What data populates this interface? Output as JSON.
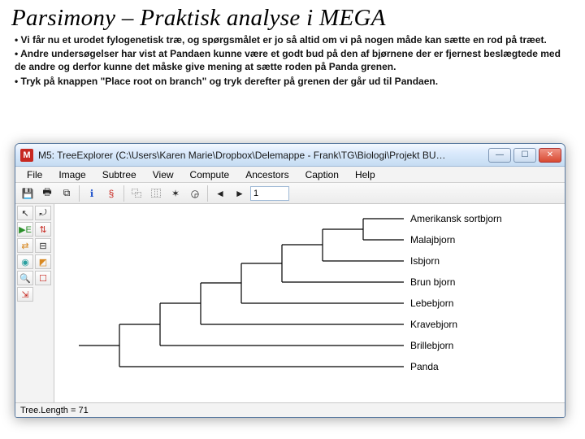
{
  "slide": {
    "title": "Parsimony – Praktisk analyse i MEGA",
    "bullets": [
      "• Vi får nu et urodet fylogenetisk træ, og spørgsmålet er jo så altid om vi på nogen måde kan sætte en rod på træet.",
      "• Andre undersøgelser har vist at Pandaen kunne være et godt bud på den af bjørnene der er fjernest beslægtede med de andre og derfor kunne det måske give mening at sætte roden på Panda grenen.",
      "• Tryk på knappen \"Place root on branch\" og tryk derefter på grenen der går ud til Pandaen."
    ]
  },
  "window": {
    "app_icon_letter": "M",
    "title": "M5: TreeExplorer (C:\\Users\\Karen Marie\\Dropbox\\Delemappe - Frank\\TG\\Biologi\\Projekt BU…",
    "win_min": "—",
    "win_max": "☐",
    "win_close": "✕",
    "menu": [
      "File",
      "Image",
      "Subtree",
      "View",
      "Compute",
      "Ancestors",
      "Caption",
      "Help"
    ],
    "toolbar_field_value": "1",
    "status": "Tree.Length = 71"
  },
  "tree": {
    "leaves": [
      "Amerikansk sortbjorn",
      "Malajbjorn",
      "Isbjorn",
      "Brun bjorn",
      "Lebebjorn",
      "Kravebjorn",
      "Brillebjorn",
      "Panda"
    ]
  }
}
